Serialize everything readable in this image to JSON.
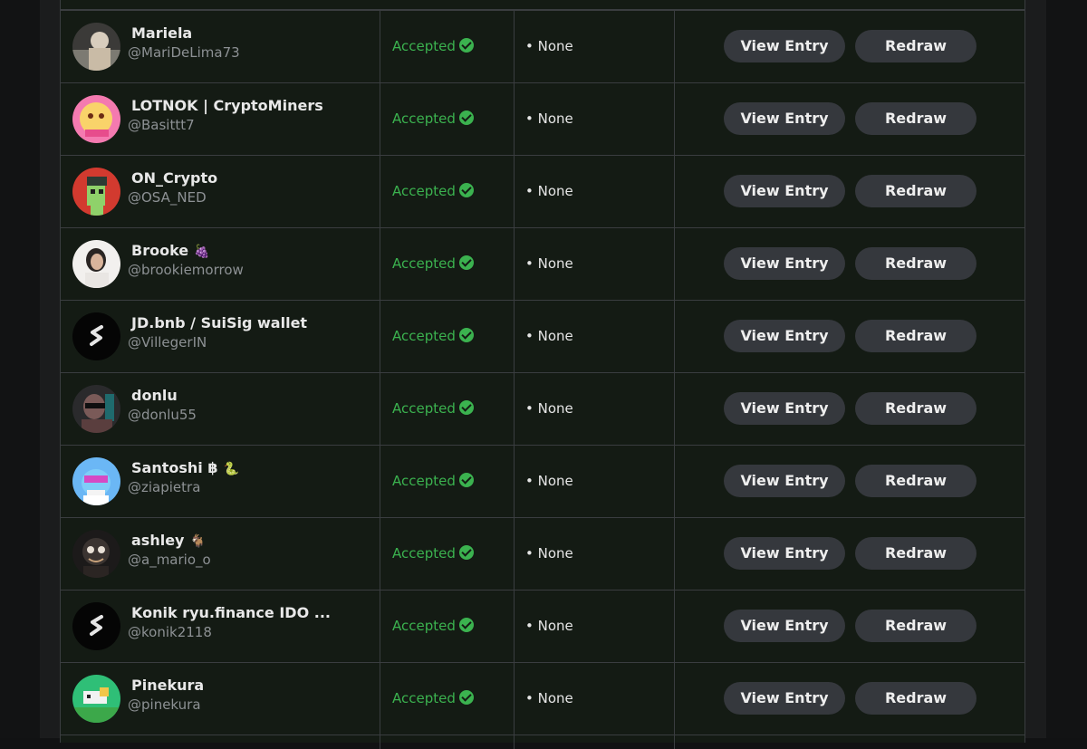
{
  "rows": [
    {
      "name": "Mariela",
      "handle": "@MariDeLima73",
      "status": "Accepted",
      "issues": "• None",
      "view_label": "View Entry",
      "redraw_label": "Redraw",
      "suffix": ""
    },
    {
      "name": "LOTNOK | CryptoMiners",
      "handle": "@Basittt7",
      "status": "Accepted",
      "issues": "• None",
      "view_label": "View Entry",
      "redraw_label": "Redraw",
      "suffix": ""
    },
    {
      "name": "ON_Crypto",
      "handle": "@OSA_NED",
      "status": "Accepted",
      "issues": "• None",
      "view_label": "View Entry",
      "redraw_label": "Redraw",
      "suffix": ""
    },
    {
      "name": "Brooke",
      "handle": "@brookiemorrow",
      "status": "Accepted",
      "issues": "• None",
      "view_label": "View Entry",
      "redraw_label": "Redraw",
      "suffix": "🍇"
    },
    {
      "name": "JD.bnb / SuiSig wallet",
      "handle": "@VillegerIN",
      "status": "Accepted",
      "issues": "• None",
      "view_label": "View Entry",
      "redraw_label": "Redraw",
      "suffix": ""
    },
    {
      "name": "donlu",
      "handle": "@donlu55",
      "status": "Accepted",
      "issues": "• None",
      "view_label": "View Entry",
      "redraw_label": "Redraw",
      "suffix": ""
    },
    {
      "name": "Santoshi ฿",
      "handle": "@ziapietra",
      "status": "Accepted",
      "issues": "• None",
      "view_label": "View Entry",
      "redraw_label": "Redraw",
      "suffix": "🐍"
    },
    {
      "name": "ashley",
      "handle": "@a_mario_o",
      "status": "Accepted",
      "issues": "• None",
      "view_label": "View Entry",
      "redraw_label": "Redraw",
      "suffix": "🐐"
    },
    {
      "name": "Konik ryu.finance IDO ...",
      "handle": "@konik2118",
      "status": "Accepted",
      "issues": "• None",
      "view_label": "View Entry",
      "redraw_label": "Redraw",
      "suffix": ""
    },
    {
      "name": "Pinekura",
      "handle": "@pinekura",
      "status": "Accepted",
      "issues": "• None",
      "view_label": "View Entry",
      "redraw_label": "Redraw",
      "suffix": ""
    }
  ],
  "colors": {
    "accent_green": "#3bb24f",
    "button_bg": "#35383d",
    "row_bg": "#141b14"
  }
}
